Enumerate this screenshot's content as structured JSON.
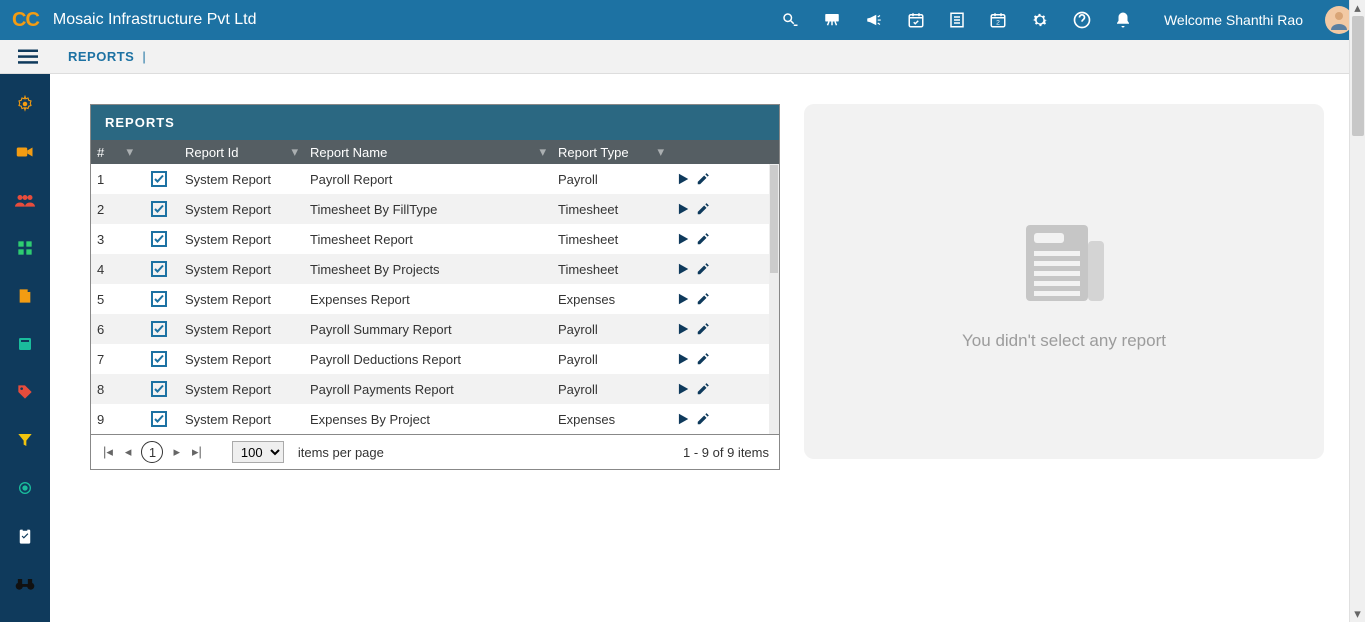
{
  "header": {
    "logo": "CC",
    "company": "Mosaic Infrastructure Pvt Ltd",
    "welcome": "Welcome Shanthi Rao"
  },
  "breadcrumb": {
    "item": "REPORTS",
    "sep": "|"
  },
  "table": {
    "title": "REPORTS",
    "columns": {
      "num": "#",
      "id": "Report Id",
      "name": "Report Name",
      "type": "Report Type"
    },
    "rows": [
      {
        "num": "1",
        "id": "System Report",
        "name": "Payroll Report",
        "type": "Payroll"
      },
      {
        "num": "2",
        "id": "System Report",
        "name": "Timesheet By FillType",
        "type": "Timesheet"
      },
      {
        "num": "3",
        "id": "System Report",
        "name": "Timesheet Report",
        "type": "Timesheet"
      },
      {
        "num": "4",
        "id": "System Report",
        "name": "Timesheet By Projects",
        "type": "Timesheet"
      },
      {
        "num": "5",
        "id": "System Report",
        "name": "Expenses Report",
        "type": "Expenses"
      },
      {
        "num": "6",
        "id": "System Report",
        "name": "Payroll Summary Report",
        "type": "Payroll"
      },
      {
        "num": "7",
        "id": "System Report",
        "name": "Payroll Deductions Report",
        "type": "Payroll"
      },
      {
        "num": "8",
        "id": "System Report",
        "name": "Payroll Payments Report",
        "type": "Payroll"
      },
      {
        "num": "9",
        "id": "System Report",
        "name": "Expenses By Project",
        "type": "Expenses"
      }
    ]
  },
  "pager": {
    "page": "1",
    "pageSize": "100",
    "itemsLabel": "items per page",
    "summary": "1 - 9 of 9 items"
  },
  "placeholder": {
    "text": "You didn't select any report"
  }
}
